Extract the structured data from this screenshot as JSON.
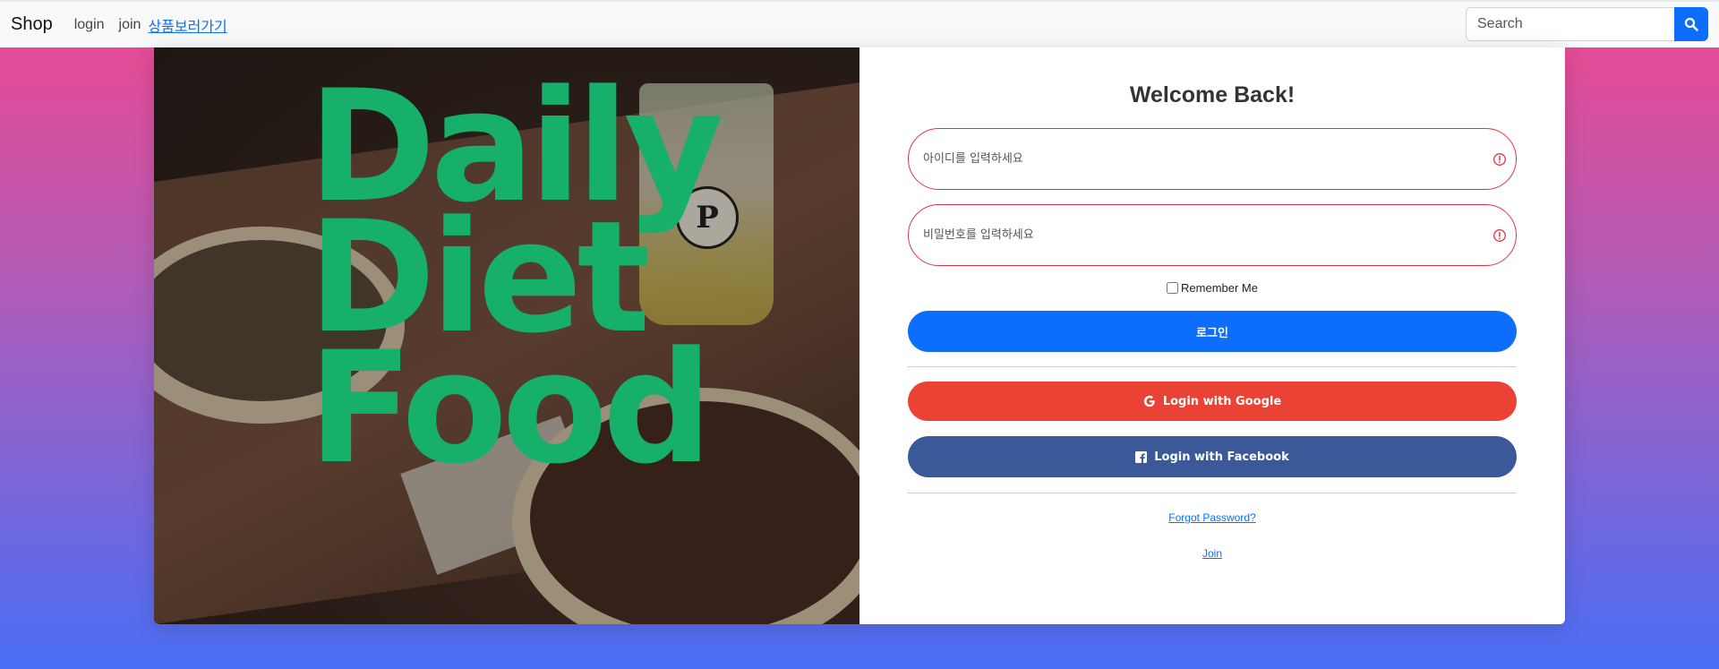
{
  "nav": {
    "brand": "Shop",
    "links": [
      "login",
      "join",
      "상품보러가기"
    ],
    "search_placeholder": "Search",
    "search_icon": "search-icon"
  },
  "hero": {
    "text_lines": [
      "Daily",
      "Diet",
      "Food"
    ],
    "cup_logo": "P",
    "accent_color": "#17b06a"
  },
  "form": {
    "title": "Welcome Back!",
    "id_placeholder": "아이디를 입력하세요",
    "password_placeholder": "비밀번호를 입력하세요",
    "remember_label": "Remember Me",
    "login_button": "로그인",
    "google_button": "Login with Google",
    "facebook_button": "Login with Facebook",
    "forgot_link": "Forgot Password?",
    "join_link": "Join"
  },
  "colors": {
    "primary": "#0d6efd",
    "google": "#ea4335",
    "facebook": "#3b5998",
    "invalid": "#dc3545"
  }
}
